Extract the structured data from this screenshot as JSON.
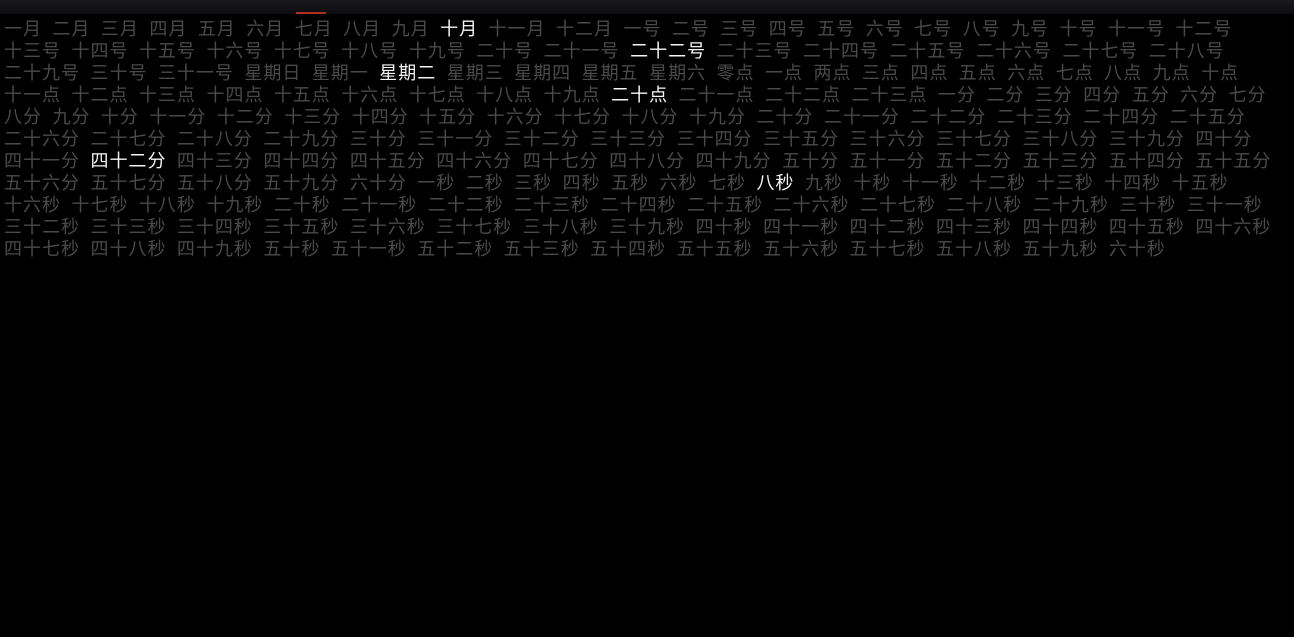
{
  "current": {
    "month_index": 9,
    "day_index": 21,
    "weekday_index": 2,
    "hour_index": 20,
    "minute_index": 41,
    "second_index": 7
  },
  "months": [
    "一月",
    "二月",
    "三月",
    "四月",
    "五月",
    "六月",
    "七月",
    "八月",
    "九月",
    "十月",
    "十一月",
    "十二月"
  ],
  "days": [
    "一号",
    "二号",
    "三号",
    "四号",
    "五号",
    "六号",
    "七号",
    "八号",
    "九号",
    "十号",
    "十一号",
    "十二号",
    "十三号",
    "十四号",
    "十五号",
    "十六号",
    "十七号",
    "十八号",
    "十九号",
    "二十号",
    "二十一号",
    "二十二号",
    "二十三号",
    "二十四号",
    "二十五号",
    "二十六号",
    "二十七号",
    "二十八号",
    "二十九号",
    "三十号",
    "三十一号"
  ],
  "weekdays": [
    "星期日",
    "星期一",
    "星期二",
    "星期三",
    "星期四",
    "星期五",
    "星期六"
  ],
  "hours": [
    "零点",
    "一点",
    "两点",
    "三点",
    "四点",
    "五点",
    "六点",
    "七点",
    "八点",
    "九点",
    "十点",
    "十一点",
    "十二点",
    "十三点",
    "十四点",
    "十五点",
    "十六点",
    "十七点",
    "十八点",
    "十九点",
    "二十点",
    "二十一点",
    "二十二点",
    "二十三点"
  ],
  "minutes": [
    "一分",
    "二分",
    "三分",
    "四分",
    "五分",
    "六分",
    "七分",
    "八分",
    "九分",
    "十分",
    "十一分",
    "十二分",
    "十三分",
    "十四分",
    "十五分",
    "十六分",
    "十七分",
    "十八分",
    "十九分",
    "二十分",
    "二十一分",
    "二十二分",
    "二十三分",
    "二十四分",
    "二十五分",
    "二十六分",
    "二十七分",
    "二十八分",
    "二十九分",
    "三十分",
    "三十一分",
    "三十二分",
    "三十三分",
    "三十四分",
    "三十五分",
    "三十六分",
    "三十七分",
    "三十八分",
    "三十九分",
    "四十分",
    "四十一分",
    "四十二分",
    "四十三分",
    "四十四分",
    "四十五分",
    "四十六分",
    "四十七分",
    "四十八分",
    "四十九分",
    "五十分",
    "五十一分",
    "五十二分",
    "五十三分",
    "五十四分",
    "五十五分",
    "五十六分",
    "五十七分",
    "五十八分",
    "五十九分",
    "六十分"
  ],
  "seconds": [
    "一秒",
    "二秒",
    "三秒",
    "四秒",
    "五秒",
    "六秒",
    "七秒",
    "八秒",
    "九秒",
    "十秒",
    "十一秒",
    "十二秒",
    "十三秒",
    "十四秒",
    "十五秒",
    "十六秒",
    "十七秒",
    "十八秒",
    "十九秒",
    "二十秒",
    "二十一秒",
    "二十二秒",
    "二十三秒",
    "二十四秒",
    "二十五秒",
    "二十六秒",
    "二十七秒",
    "二十八秒",
    "二十九秒",
    "三十秒",
    "三十一秒",
    "三十二秒",
    "三十三秒",
    "三十四秒",
    "三十五秒",
    "三十六秒",
    "三十七秒",
    "三十八秒",
    "三十九秒",
    "四十秒",
    "四十一秒",
    "四十二秒",
    "四十三秒",
    "四十四秒",
    "四十五秒",
    "四十六秒",
    "四十七秒",
    "四十八秒",
    "四十九秒",
    "五十秒",
    "五十一秒",
    "五十二秒",
    "五十三秒",
    "五十四秒",
    "五十五秒",
    "五十六秒",
    "五十七秒",
    "五十八秒",
    "五十九秒",
    "六十秒"
  ]
}
